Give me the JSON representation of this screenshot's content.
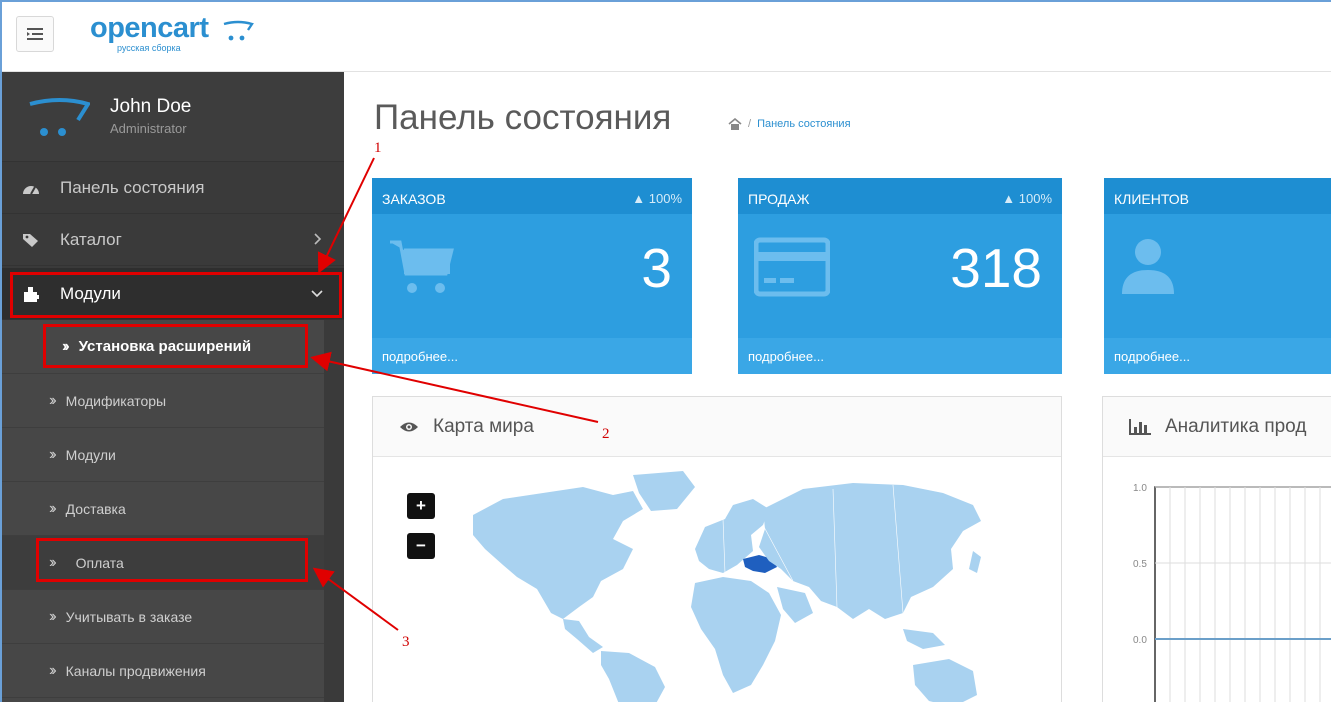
{
  "header": {
    "logo_text": "opencart",
    "logo_subtitle": "русская сборка"
  },
  "profile": {
    "name": "John Doe",
    "role": "Administrator"
  },
  "nav": {
    "dashboard": "Панель состояния",
    "catalog": "Каталог",
    "modules": "Модули"
  },
  "submenu": {
    "extensions_install": "Установка расширений",
    "modifications": "Модификаторы",
    "modules": "Модули",
    "shipping": "Доставка",
    "payment": "Оплата",
    "order_totals": "Учитывать в заказе",
    "feeds": "Каналы продвижения"
  },
  "page": {
    "title": "Панель состояния",
    "breadcrumb_separator": "/",
    "breadcrumb_current": "Панель состояния"
  },
  "tiles": {
    "orders": {
      "label": "ЗАКАЗОВ",
      "pct": "100%",
      "value": "3",
      "more": "подробнее..."
    },
    "sales": {
      "label": "ПРОДАЖ",
      "pct": "100%",
      "value": "318",
      "more": "подробнее..."
    },
    "customers": {
      "label": "КЛИЕНТОВ",
      "more": "подробнее..."
    }
  },
  "panels": {
    "map_title": "Карта мира",
    "analytics_title": "Аналитика прод",
    "zoom_in": "+",
    "zoom_out": "−"
  },
  "chart_data": {
    "type": "line",
    "y_ticks": [
      "1.0",
      "0.5",
      "0.0"
    ],
    "ylim": [
      0,
      1
    ],
    "series": [
      {
        "values": [
          0,
          0,
          0,
          0,
          0,
          0,
          0,
          0,
          0,
          0,
          0,
          0
        ]
      }
    ]
  },
  "annotations": {
    "label_1": "1",
    "label_2": "2",
    "label_3": "3"
  },
  "colors": {
    "brand": "#2b8fd0",
    "tile": "#2d9ee0",
    "annotation": "#e00000",
    "sidebar": "#3a3a3a",
    "map_land": "#a9d2f0",
    "map_highlight": "#1f5fbf"
  }
}
